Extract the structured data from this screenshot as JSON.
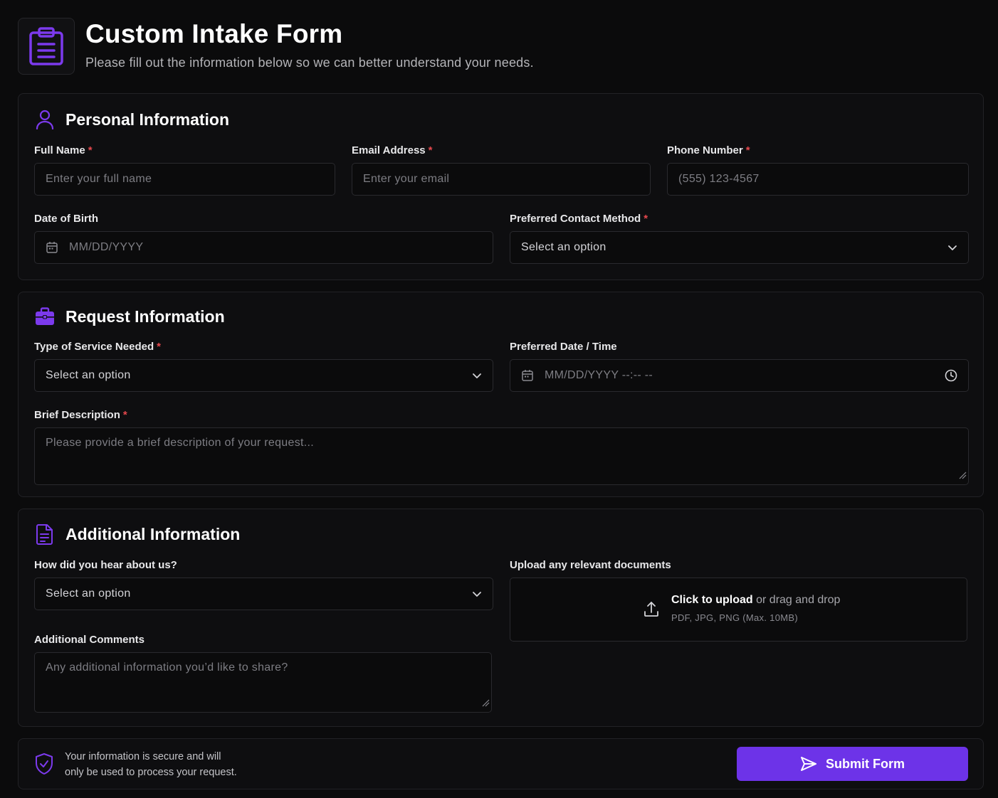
{
  "header": {
    "icon": "clipboard-icon",
    "title": "Custom Intake Form",
    "subtitle": "Please fill out the information below so we can better understand your needs."
  },
  "colors": {
    "accent": "#6d33e8",
    "icon_accent": "#7c3aed",
    "required": "#e5484d",
    "background": "#0b0b0c"
  },
  "personal": {
    "title": "Personal Information",
    "icon": "user-icon",
    "full_name": {
      "label": "Full Name",
      "required": "*",
      "placeholder": "Enter your full name"
    },
    "email": {
      "label": "Email Address",
      "required": "*",
      "placeholder": "Enter your email"
    },
    "phone": {
      "label": "Phone Number",
      "required": "*",
      "placeholder": "(555) 123-4567"
    },
    "dob": {
      "label": "Date of Birth",
      "placeholder": "MM/DD/YYYY"
    },
    "contact_method": {
      "label": "Preferred Contact Method",
      "required": "*",
      "value": "Select an option"
    }
  },
  "request": {
    "title": "Request Information",
    "icon": "briefcase-icon",
    "service_type": {
      "label": "Type of Service Needed",
      "required": "*",
      "value": "Select an option"
    },
    "preferred_datetime": {
      "label": "Preferred Date / Time",
      "placeholder": "MM/DD/YYYY --:-- --"
    },
    "description": {
      "label": "Brief Description",
      "required": "*",
      "placeholder": "Please provide a brief description of your request..."
    }
  },
  "additional": {
    "title": "Additional Information",
    "icon": "document-icon",
    "referral": {
      "label": "How did you hear about us?",
      "value": "Select an option"
    },
    "upload": {
      "label": "Upload any relevant documents",
      "click_text": "Click to upload",
      "drag_text": "or drag and drop",
      "hint": "PDF, JPG, PNG (Max. 10MB)"
    },
    "comments": {
      "label": "Additional Comments",
      "placeholder": "Any additional information you’d like to share?"
    }
  },
  "footer": {
    "secure_line1": "Your information is secure and will",
    "secure_line2": "only be used to process your request.",
    "submit_label": "Submit Form"
  }
}
